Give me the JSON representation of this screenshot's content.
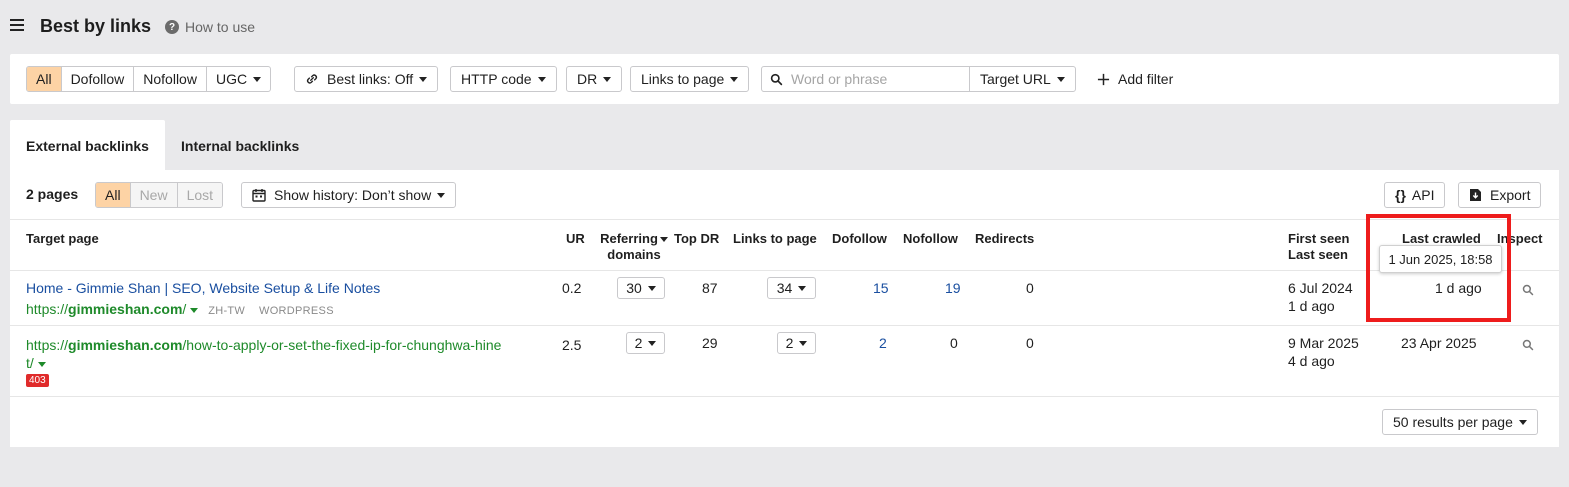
{
  "header": {
    "title": "Best by links",
    "how_to": "How to use"
  },
  "filters": {
    "link_type": [
      "All",
      "Dofollow",
      "Nofollow",
      "UGC"
    ],
    "best_links": "Best links: Off",
    "http_code": "HTTP code",
    "dr": "DR",
    "links_to_page": "Links to page",
    "search_placeholder": "Word or phrase",
    "target_url": "Target URL",
    "add_filter": "Add filter"
  },
  "tabs": [
    "External backlinks",
    "Internal backlinks"
  ],
  "toolbar": {
    "pages_count": "2 pages",
    "status_seg": [
      "All",
      "New",
      "Lost"
    ],
    "show_history": "Show history: Don’t show",
    "api": "API",
    "export": "Export"
  },
  "columns": {
    "target_page": "Target page",
    "ur": "UR",
    "referring_1": "Referring",
    "referring_2": "domains",
    "top_dr": "Top DR",
    "links_to_page": "Links to page",
    "dofollow": "Dofollow",
    "nofollow": "Nofollow",
    "redirects": "Redirects",
    "first_seen": "First seen",
    "last_seen": "Last seen",
    "last_crawled": "Last crawled",
    "inspect": "Inspect"
  },
  "rows": [
    {
      "title": "Home - Gimmie Shan | SEO, Website Setup & Life Notes",
      "url_prefix": "https://",
      "url_domain": "gimmieshan.com",
      "url_path": "/",
      "lang": "ZH-TW",
      "cms": "WORDPRESS",
      "ur": "0.2",
      "ref_domains": "30",
      "top_dr": "87",
      "links_to_page": "34",
      "dofollow": "15",
      "nofollow": "19",
      "redirects": "0",
      "first_seen": "6 Jul 2024",
      "last_seen": "1 d ago",
      "last_crawled": "1 d ago"
    },
    {
      "url_prefix": "https://",
      "url_domain": "gimmieshan.com",
      "url_path_line1": "/how-to-apply-or-set-the-fixed-ip-for-chunghwa-hine",
      "url_path_line2": "t/",
      "status_code": "403",
      "ur": "2.5",
      "ref_domains": "2",
      "top_dr": "29",
      "links_to_page": "2",
      "dofollow": "2",
      "nofollow": "0",
      "redirects": "0",
      "first_seen": "9 Mar 2025",
      "last_seen": "4 d ago",
      "last_crawled": "23 Apr 2025"
    }
  ],
  "tooltip": "1 Jun 2025, 18:58",
  "pagination": {
    "per_page": "50 results per page"
  },
  "colors": {
    "active_segment": "#fdd3a5",
    "link_blue": "#1a4fa0",
    "link_green": "#1e8a2a",
    "highlight_red": "#ee1c1c",
    "badge_red": "#e02b2b"
  }
}
